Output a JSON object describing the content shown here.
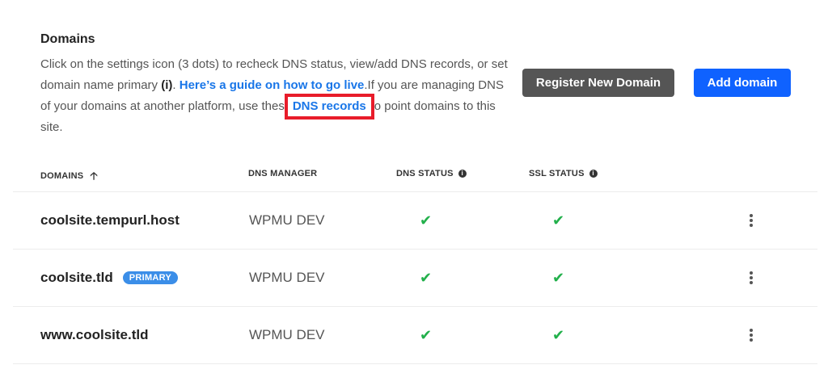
{
  "section": {
    "title": "Domains",
    "desc_part1": "Click on the settings icon (3 dots) to recheck DNS status, view/add DNS records, or set domain name primary ",
    "desc_info": "(i)",
    "desc_part2": ". ",
    "guide_link": "Here’s a guide on how to go live",
    "desc_part3": ".If you are managing DNS of your domains at another platform, use thes",
    "dns_link": "DNS records",
    "desc_part4": "o point domains to this site."
  },
  "buttons": {
    "register": "Register New Domain",
    "add": "Add domain"
  },
  "table": {
    "headers": {
      "domains": "DOMAINS",
      "dns_manager": "DNS MANAGER",
      "dns_status": "DNS STATUS",
      "ssl_status": "SSL STATUS"
    },
    "rows": [
      {
        "domain": "coolsite.tempurl.host",
        "badge": "",
        "manager": "WPMU DEV",
        "dns_ok": "✔",
        "ssl_ok": "✔"
      },
      {
        "domain": "coolsite.tld",
        "badge": "PRIMARY",
        "manager": "WPMU DEV",
        "dns_ok": "✔",
        "ssl_ok": "✔"
      },
      {
        "domain": "www.coolsite.tld",
        "badge": "",
        "manager": "WPMU DEV",
        "dns_ok": "✔",
        "ssl_ok": "✔"
      }
    ]
  },
  "icons": {
    "sort": "arrow-up-icon",
    "info": "info-icon",
    "check": "check-icon",
    "menu": "kebab-menu-icon"
  },
  "colors": {
    "link": "#1976e8",
    "primary_button": "#0f62ff",
    "secondary_button": "#555555",
    "badge": "#3b8ee8",
    "check": "#22b04b",
    "highlight": "#e81c2a"
  }
}
